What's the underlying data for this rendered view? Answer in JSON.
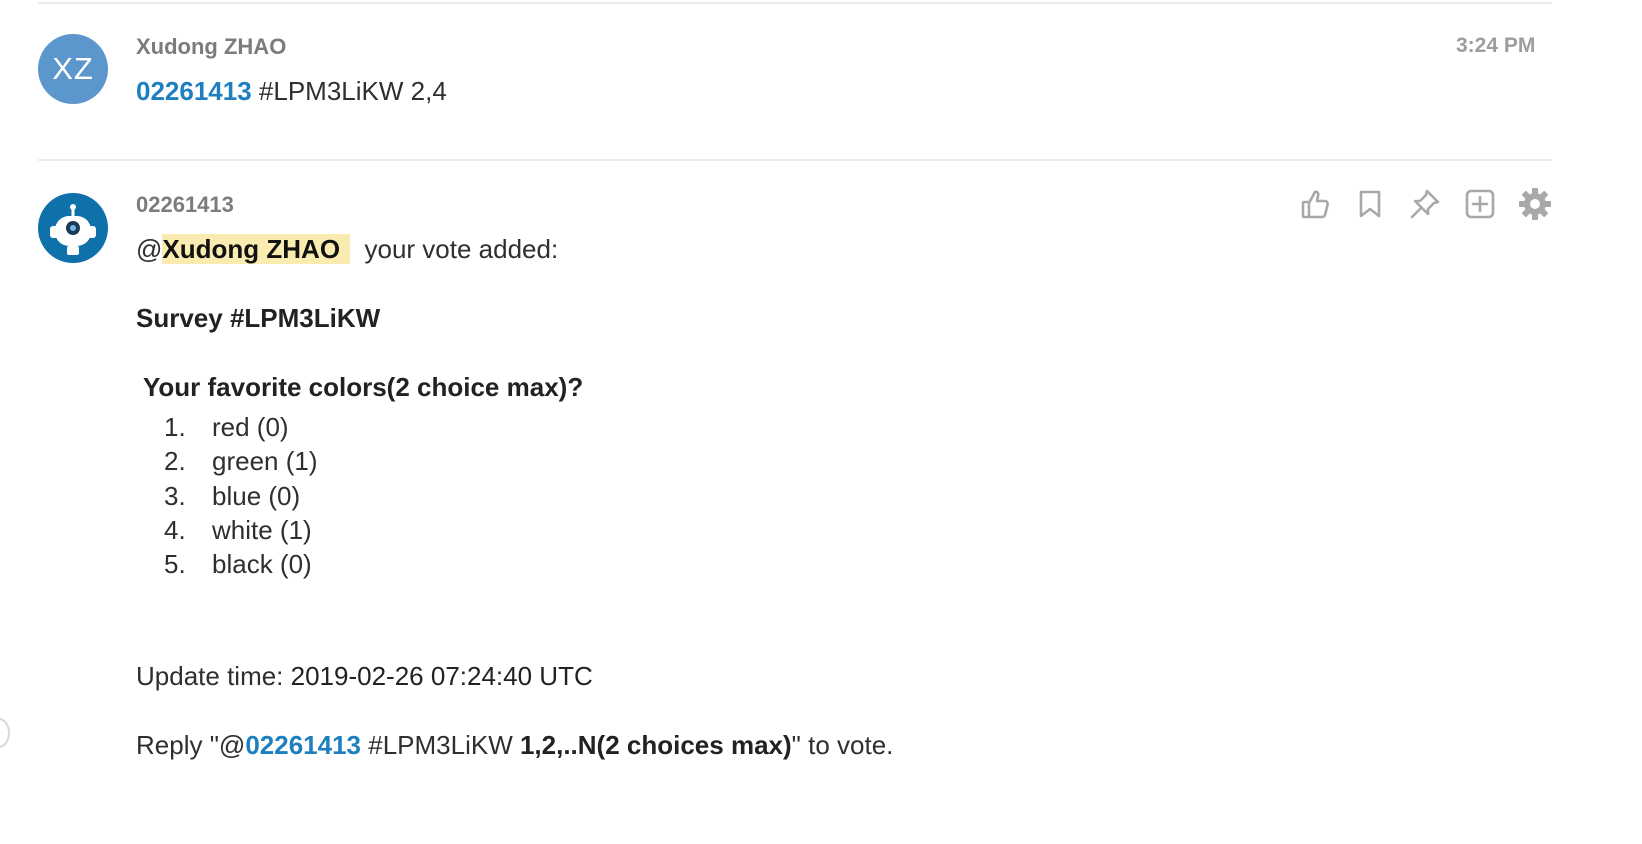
{
  "messages": [
    {
      "sender": "Xudong ZHAO",
      "avatar_initials": "XZ",
      "time": "3:24 PM",
      "text": {
        "link": "02261413",
        "rest": " #LPM3LiKW 2,4"
      }
    },
    {
      "sender": "02261413",
      "avatar_icon": "robot-icon",
      "mention_prefix": "@",
      "mention_name": "Xudong ZHAO",
      "mention_suffix": "your vote added:",
      "survey_title": "Survey #LPM3LiKW",
      "question": "Your favorite colors(2 choice max)?",
      "options": [
        {
          "num": "1.",
          "label": "red (0)"
        },
        {
          "num": "2.",
          "label": "green (1)"
        },
        {
          "num": "3.",
          "label": "blue (0)"
        },
        {
          "num": "4.",
          "label": "white (1)"
        },
        {
          "num": "5.",
          "label": "black (0)"
        }
      ],
      "update_label": "Update time: ",
      "update_value": "2019-02-26 07:24:40 UTC",
      "reply": {
        "pre": "Reply \"@",
        "link": "02261413",
        "mid": " #LPM3LiKW ",
        "bold": "1,2,..N(2 choices max)",
        "post": "\" to vote."
      },
      "actions": [
        "thumbs-up-icon",
        "bookmark-icon",
        "pin-icon",
        "add-reaction-icon",
        "gear-icon"
      ]
    }
  ],
  "colors": {
    "link": "#1d7fc0",
    "avatar_xz": "#5b96cc",
    "bot_avatar": "#0f71aa",
    "mention_bg": "#faecb0"
  }
}
